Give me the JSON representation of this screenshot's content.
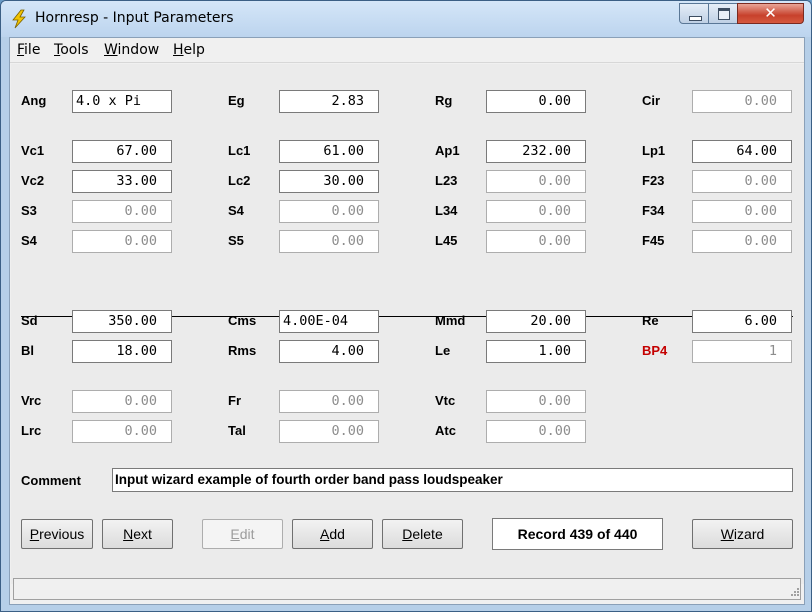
{
  "window": {
    "title": "Hornresp - Input Parameters",
    "close_glyph": "✕"
  },
  "menu": [
    {
      "label": "File",
      "mnemonic": "F",
      "rest": "ile"
    },
    {
      "label": "Tools",
      "mnemonic": "T",
      "rest": "ools"
    },
    {
      "label": "Window",
      "mnemonic": "W",
      "rest": "indow"
    },
    {
      "label": "Help",
      "mnemonic": "H",
      "rest": "elp"
    }
  ],
  "params": {
    "Ang": "4.0 x Pi",
    "Eg": "2.83",
    "Rg": "0.00",
    "Cir": "0.00",
    "Vc1": "67.00",
    "Lc1": "61.00",
    "Ap1": "232.00",
    "Lp1": "64.00",
    "Vc2": "33.00",
    "Lc2": "30.00",
    "L23": "0.00",
    "F23": "0.00",
    "S3": "0.00",
    "S4a": "0.00",
    "L34": "0.00",
    "F34": "0.00",
    "S4": "0.00",
    "S5": "0.00",
    "L45": "0.00",
    "F45": "0.00",
    "Sd": "350.00",
    "Cms": "4.00E-04",
    "Mmd": "20.00",
    "Re": "6.00",
    "Bl": "18.00",
    "Rms": "4.00",
    "Le": "1.00",
    "BP4": "1",
    "Vrc": "0.00",
    "Fr": "0.00",
    "Vtc": "0.00",
    "Lrc": "0.00",
    "Tal": "0.00",
    "Atc": "0.00"
  },
  "labels": {
    "Ang": "Ang",
    "Eg": "Eg",
    "Rg": "Rg",
    "Cir": "Cir",
    "Vc1": "Vc1",
    "Lc1": "Lc1",
    "Ap1": "Ap1",
    "Lp1": "Lp1",
    "Vc2": "Vc2",
    "Lc2": "Lc2",
    "L23": "L23",
    "F23": "F23",
    "S3": "S3",
    "S4a": "S4",
    "L34": "L34",
    "F34": "F34",
    "S4": "S4",
    "S5": "S5",
    "L45": "L45",
    "F45": "F45",
    "Sd": "Sd",
    "Cms": "Cms",
    "Mmd": "Mmd",
    "Re": "Re",
    "Bl": "Bl",
    "Rms": "Rms",
    "Le": "Le",
    "BP4": "BP4",
    "Vrc": "Vrc",
    "Fr": "Fr",
    "Vtc": "Vtc",
    "Lrc": "Lrc",
    "Tal": "Tal",
    "Atc": "Atc"
  },
  "comment": {
    "label": "Comment",
    "value": "Input wizard example of fourth order band pass loudspeaker"
  },
  "buttons": {
    "previous": {
      "mnemonic": "P",
      "rest": "revious"
    },
    "next": {
      "mnemonic": "N",
      "rest": "ext"
    },
    "edit": {
      "mnemonic": "E",
      "rest": "dit"
    },
    "add": {
      "mnemonic": "A",
      "rest": "dd"
    },
    "delete": {
      "mnemonic": "D",
      "rest": "elete"
    },
    "wizard": {
      "mnemonic": "W",
      "rest": "izard"
    }
  },
  "record": "Record 439 of 440",
  "colors": {
    "accent_label": "#c40000",
    "app_icon": "#f0c000"
  }
}
